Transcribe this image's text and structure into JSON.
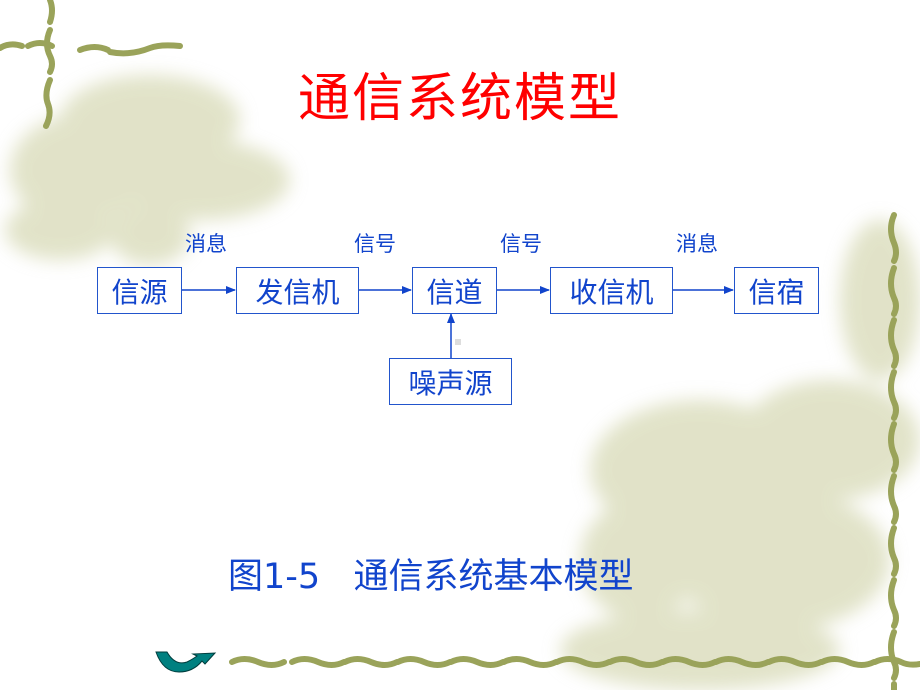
{
  "slide": {
    "title": "通信系统模型",
    "caption": "图1-5   通信系统基本模型",
    "colors": {
      "title": "#ff0000",
      "diagram": "#1144cc",
      "border_vine": "#9aa35a",
      "nav_arrow": "#008080"
    }
  },
  "diagram": {
    "nodes": [
      {
        "id": "source",
        "label": "信源"
      },
      {
        "id": "transmitter",
        "label": "发信机"
      },
      {
        "id": "channel",
        "label": "信道"
      },
      {
        "id": "receiver",
        "label": "收信机"
      },
      {
        "id": "sink",
        "label": "信宿"
      },
      {
        "id": "noise",
        "label": "噪声源"
      }
    ],
    "edge_labels": [
      "消息",
      "信号",
      "信号",
      "消息"
    ],
    "edges": [
      {
        "from": "source",
        "to": "transmitter"
      },
      {
        "from": "transmitter",
        "to": "channel"
      },
      {
        "from": "channel",
        "to": "receiver"
      },
      {
        "from": "receiver",
        "to": "sink"
      },
      {
        "from": "noise",
        "to": "channel"
      }
    ]
  },
  "navigation": {
    "icon": "curved-arrow-return-icon"
  }
}
